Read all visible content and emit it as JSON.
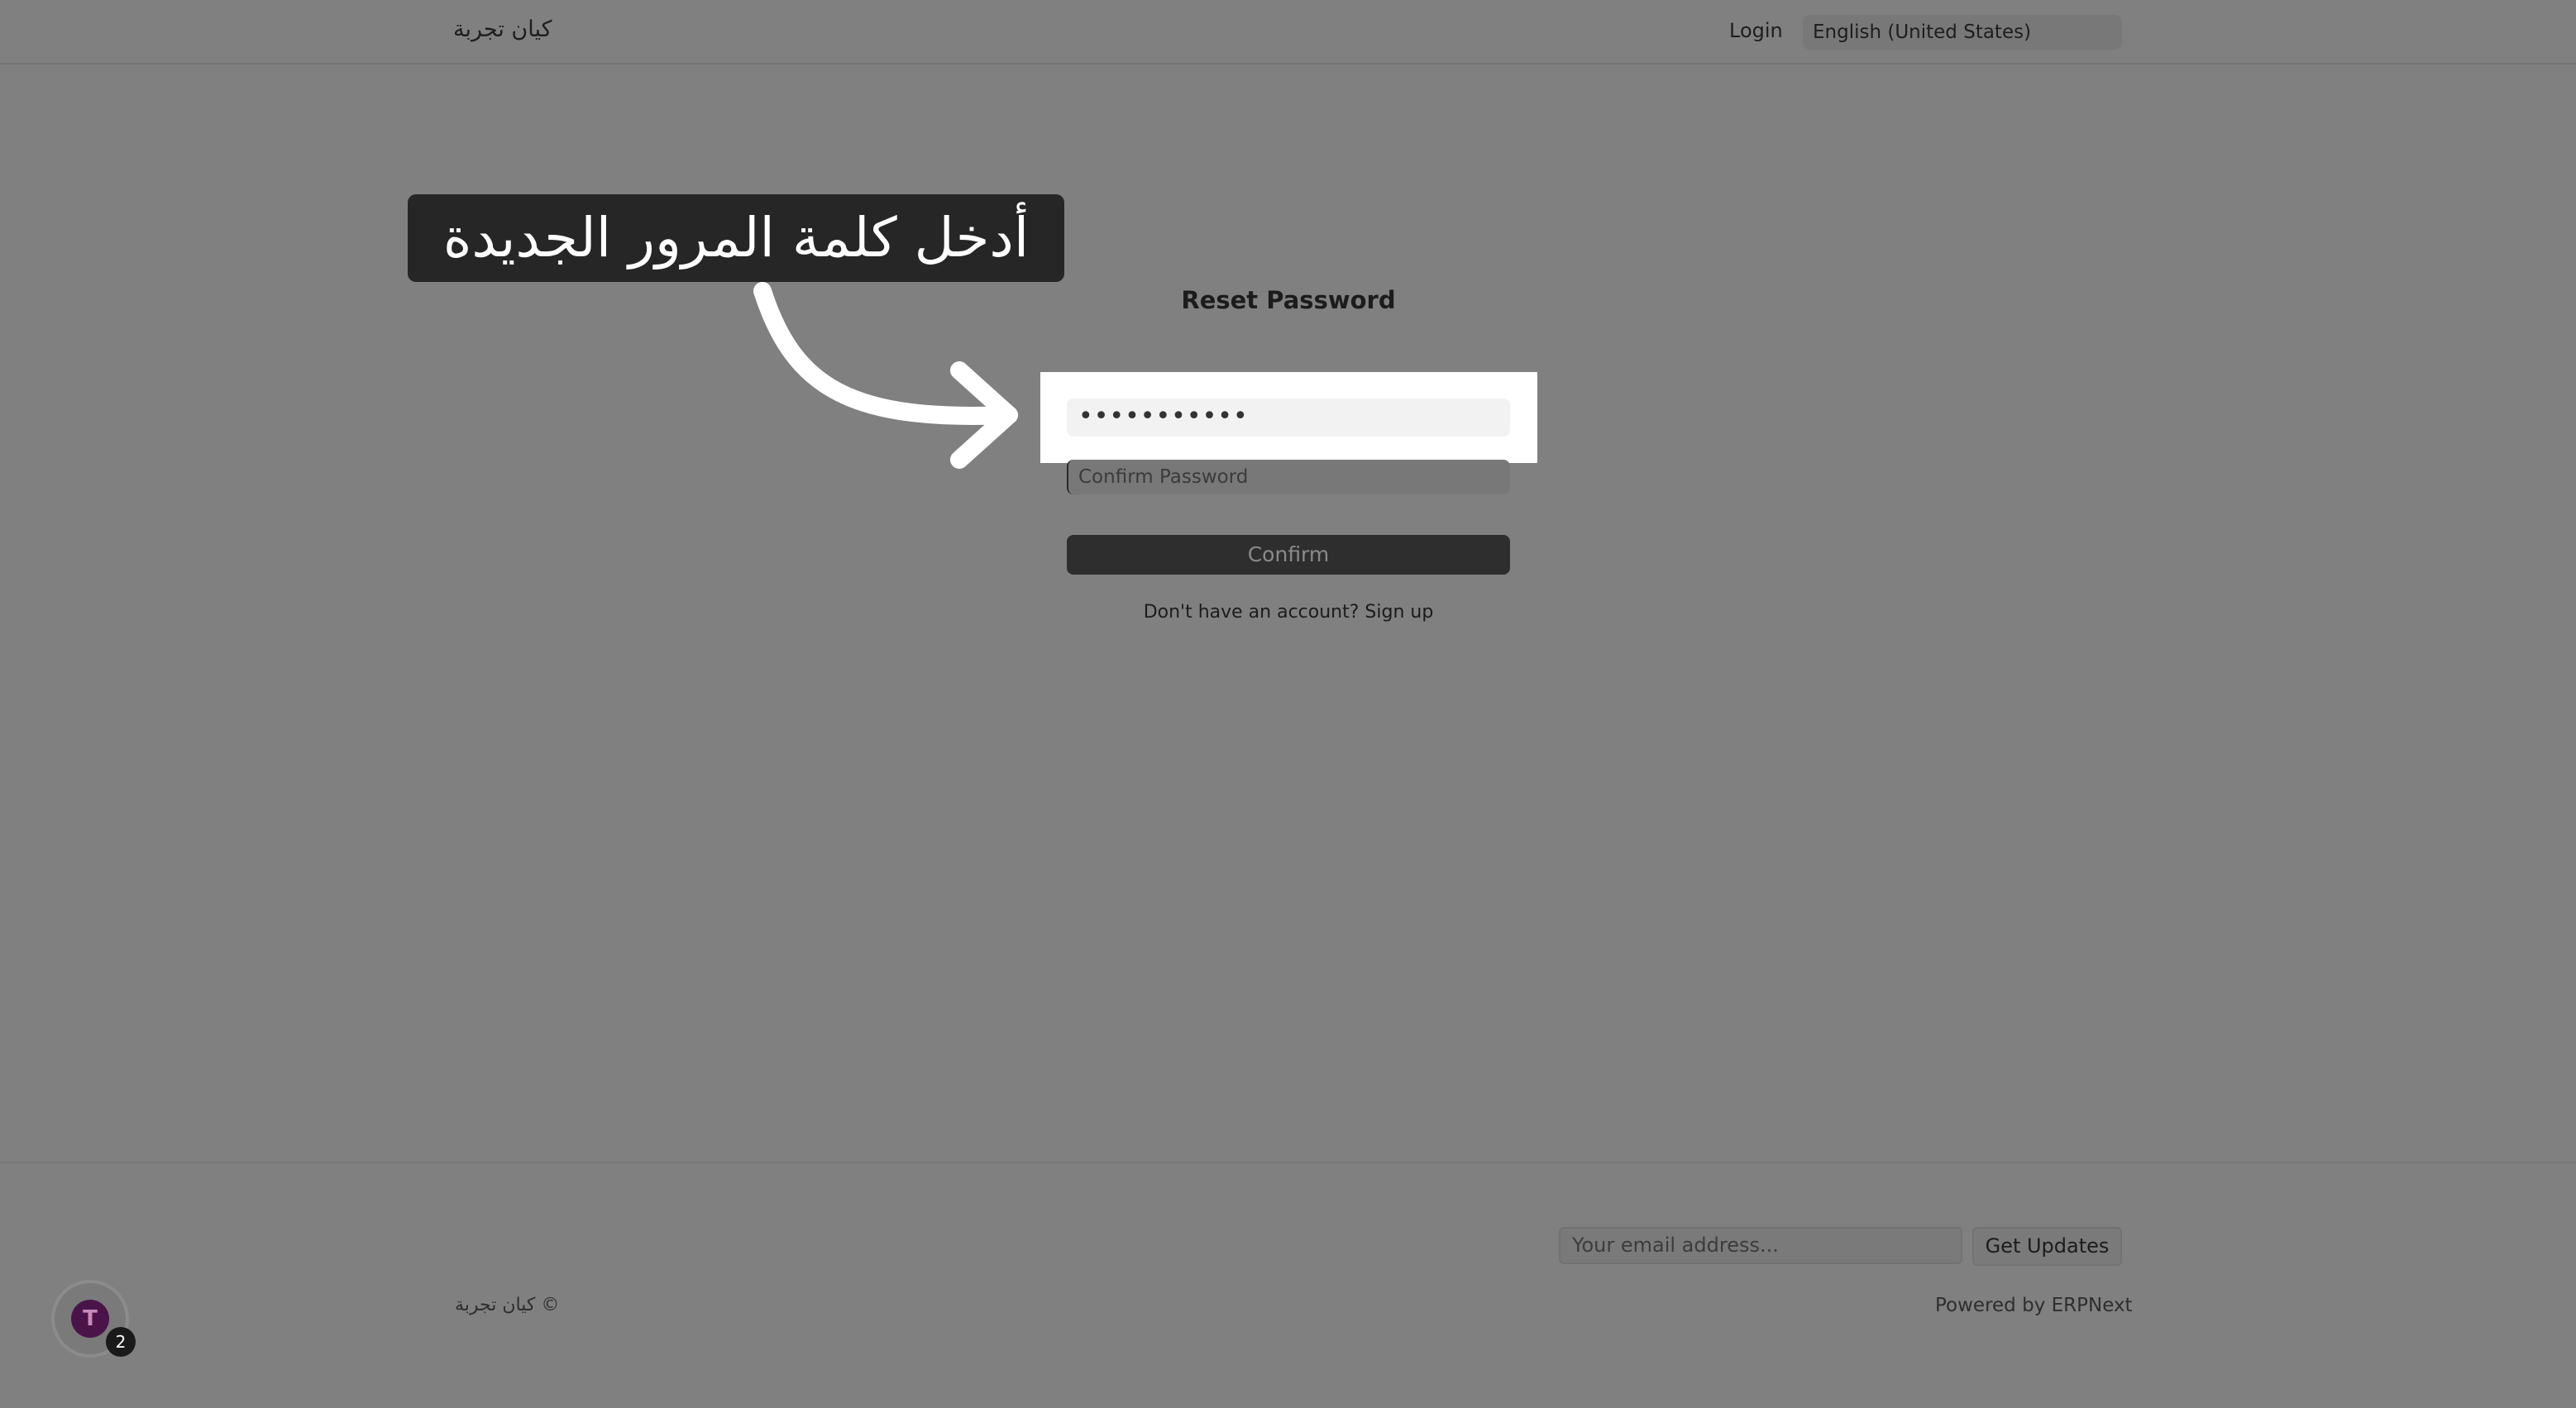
{
  "navbar": {
    "brand": "كيان تجربة",
    "login_label": "Login",
    "language": "English (United States)"
  },
  "form": {
    "title": "Reset Password",
    "new_password_value": "•••••••••••",
    "confirm_password_placeholder": "Confirm Password",
    "confirm_button_label": "Confirm",
    "no_account_text": "Don't have an account?",
    "signup_label": "Sign up"
  },
  "callout": {
    "text": "أدخل كلمة المرور الجديدة"
  },
  "footer": {
    "email_placeholder": "Your email address...",
    "get_updates_label": "Get Updates",
    "copyright": "كيان تجربة ©",
    "powered_by": "Powered by ERPNext"
  },
  "avatar": {
    "initial": "T",
    "badge_count": "2"
  },
  "colors": {
    "overlay": "#808080",
    "highlight": "#ffffff",
    "callout_bg": "#262626"
  }
}
